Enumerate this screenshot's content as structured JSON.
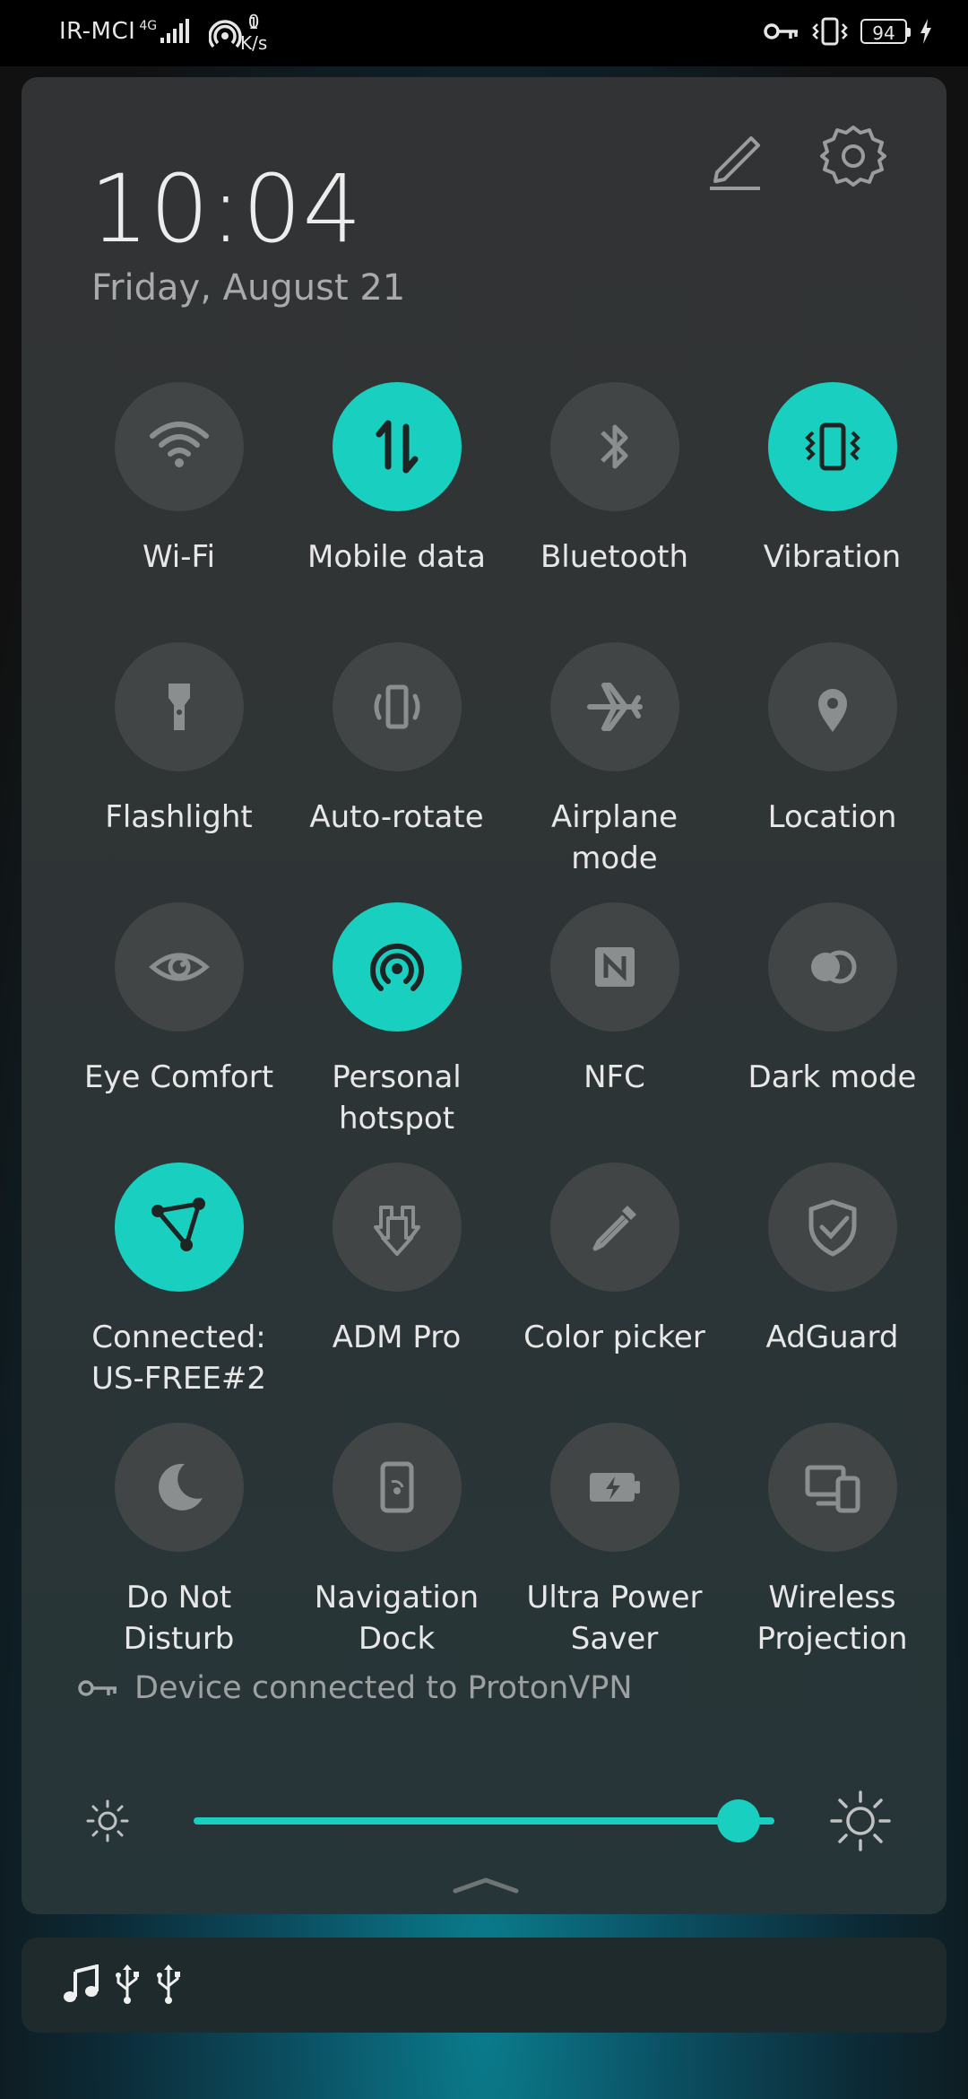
{
  "status_bar": {
    "carrier": "IR-MCI",
    "network_type": "4G",
    "hotspot_count": "1",
    "speed_value": "0",
    "speed_unit": "K/s",
    "battery": "94"
  },
  "header": {
    "time": "10:04",
    "date": "Friday, August 21"
  },
  "tiles": [
    {
      "label": "Wi-Fi",
      "icon": "wifi-icon",
      "active": false
    },
    {
      "label": "Mobile data",
      "icon": "mobile-data-icon",
      "active": true
    },
    {
      "label": "Bluetooth",
      "icon": "bluetooth-icon",
      "active": false
    },
    {
      "label": "Vibration",
      "icon": "vibration-icon",
      "active": true
    },
    {
      "label": "Flashlight",
      "icon": "flashlight-icon",
      "active": false
    },
    {
      "label": "Auto-rotate",
      "icon": "auto-rotate-icon",
      "active": false
    },
    {
      "label": "Airplane\nmode",
      "icon": "airplane-icon",
      "active": false
    },
    {
      "label": "Location",
      "icon": "location-pin-icon",
      "active": false
    },
    {
      "label": "Eye Comfort",
      "icon": "eye-icon",
      "active": false
    },
    {
      "label": "Personal\nhotspot",
      "icon": "hotspot-icon",
      "active": true
    },
    {
      "label": "NFC",
      "icon": "nfc-icon",
      "active": false
    },
    {
      "label": "Dark mode",
      "icon": "dark-mode-icon",
      "active": false
    },
    {
      "label": "Connected:\nUS-FREE#2",
      "icon": "vpn-triangle-icon",
      "active": true
    },
    {
      "label": "ADM Pro",
      "icon": "adm-download-icon",
      "active": false
    },
    {
      "label": "Color picker",
      "icon": "eyedropper-icon",
      "active": false
    },
    {
      "label": "AdGuard",
      "icon": "shield-check-icon",
      "active": false
    },
    {
      "label": "Do Not\nDisturb",
      "icon": "moon-icon",
      "active": false
    },
    {
      "label": "Navigation\nDock",
      "icon": "navigation-dock-icon",
      "active": false
    },
    {
      "label": "Ultra Power\nSaver",
      "icon": "battery-bolt-icon",
      "active": false
    },
    {
      "label": "Wireless\nProjection",
      "icon": "projection-icon",
      "active": false
    }
  ],
  "vpn_notice": "Device connected to ProtonVPN",
  "brightness": {
    "level": 0.95
  },
  "accent_color": "#19cfbf"
}
